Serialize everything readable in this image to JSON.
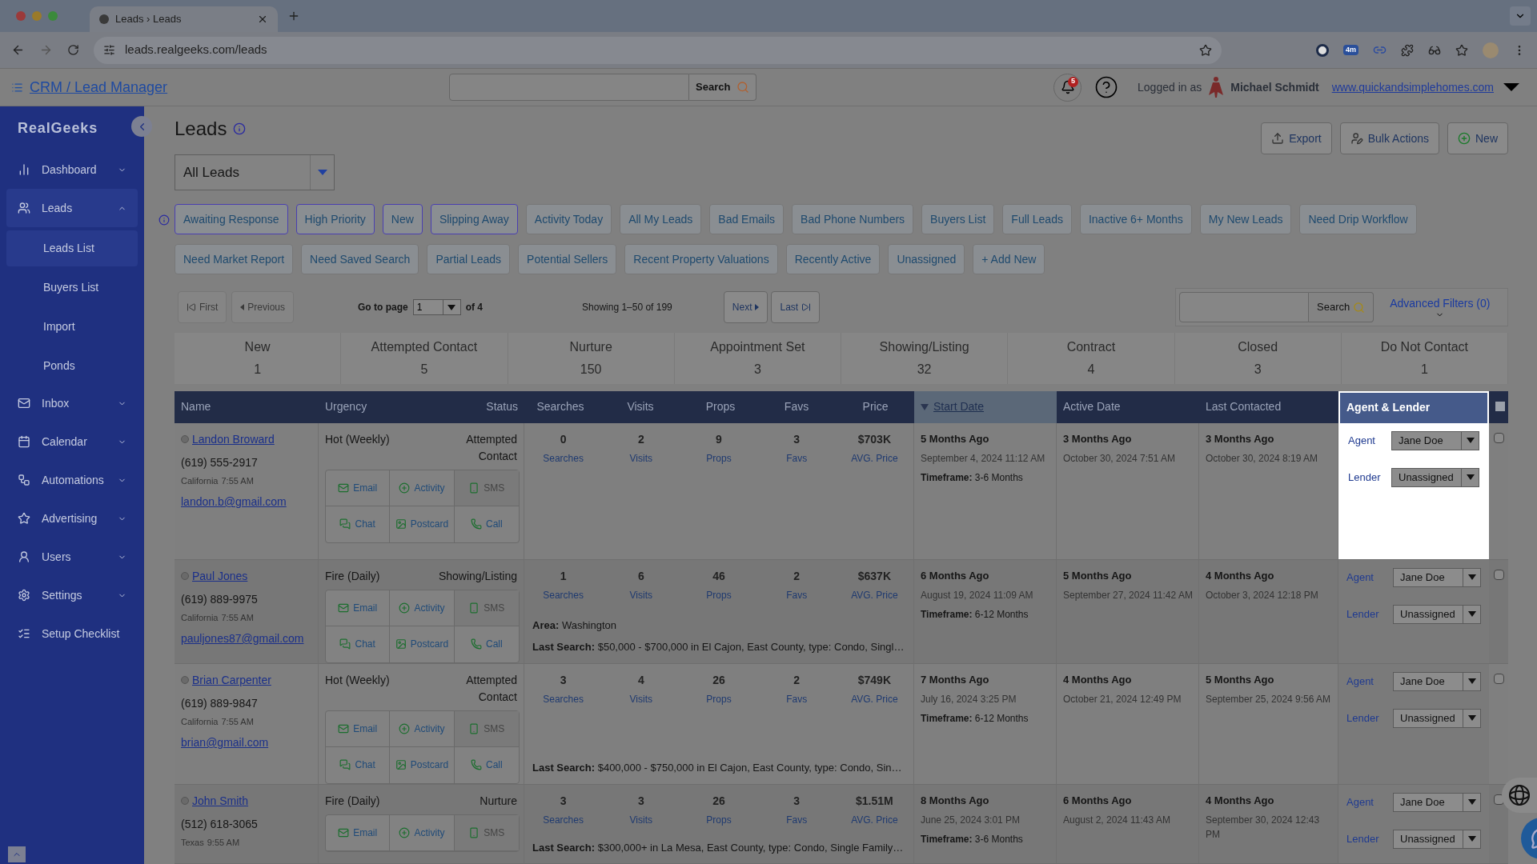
{
  "browser": {
    "tab_title": "Leads › Leads",
    "url": "leads.realgeeks.com/leads",
    "extension_badge": "4m"
  },
  "header": {
    "title": "CRM / Lead Manager",
    "search_button": "Search",
    "notifications": "5",
    "logged_in_label": "Logged in as",
    "user": "Michael Schmidt",
    "site": "www.quickandsimplehomes.com"
  },
  "sidebar": {
    "logo": "RealGeeks",
    "items": [
      {
        "label": "Dashboard",
        "kind": "menu",
        "expanded": false
      },
      {
        "label": "Leads",
        "kind": "menu",
        "expanded": true,
        "children": [
          {
            "label": "Leads List",
            "selected": true
          },
          {
            "label": "Buyers List",
            "selected": false
          },
          {
            "label": "Import",
            "selected": false
          },
          {
            "label": "Ponds",
            "selected": false
          }
        ]
      },
      {
        "label": "Inbox",
        "kind": "menu",
        "expanded": false
      },
      {
        "label": "Calendar",
        "kind": "menu",
        "expanded": false
      },
      {
        "label": "Automations",
        "kind": "menu",
        "expanded": false
      },
      {
        "label": "Advertising",
        "kind": "menu",
        "expanded": false
      },
      {
        "label": "Users",
        "kind": "menu",
        "expanded": false
      },
      {
        "label": "Settings",
        "kind": "menu",
        "expanded": false
      },
      {
        "label": "Setup Checklist",
        "kind": "link",
        "expanded": false
      }
    ]
  },
  "page": {
    "title": "Leads",
    "view": "All Leads",
    "actions": [
      "Export",
      "Bulk Actions",
      "New"
    ]
  },
  "filters": [
    {
      "label": "Awaiting Response",
      "selected": true
    },
    {
      "label": "High Priority",
      "selected": true
    },
    {
      "label": "New",
      "selected": true
    },
    {
      "label": "Slipping Away",
      "selected": true
    },
    {
      "label": "Activity Today",
      "selected": false
    },
    {
      "label": "All My Leads",
      "selected": false
    },
    {
      "label": "Bad Emails",
      "selected": false
    },
    {
      "label": "Bad Phone Numbers",
      "selected": false
    },
    {
      "label": "Buyers List",
      "selected": false
    },
    {
      "label": "Full Leads",
      "selected": false
    },
    {
      "label": "Inactive 6+ Months",
      "selected": false
    },
    {
      "label": "My New Leads",
      "selected": false
    },
    {
      "label": "Need Drip Workflow",
      "selected": false
    },
    {
      "label": "Need Market Report",
      "selected": false
    },
    {
      "label": "Need Saved Search",
      "selected": false
    },
    {
      "label": "Partial Leads",
      "selected": false
    },
    {
      "label": "Potential Sellers",
      "selected": false
    },
    {
      "label": "Recent Property Valuations",
      "selected": false
    },
    {
      "label": "Recently Active",
      "selected": false
    },
    {
      "label": "Unassigned",
      "selected": false
    },
    {
      "label": "+ Add New",
      "selected": false
    }
  ],
  "pagination": {
    "first": "First",
    "first_disabled": true,
    "previous": "Previous",
    "previous_disabled": true,
    "go_to_label": "Go to page",
    "page": "1",
    "of": "of 4",
    "showing": "Showing 1–50 of 199",
    "next": "Next",
    "last": "Last",
    "search_button": "Search",
    "advanced_filters": "Advanced Filters (0)"
  },
  "stages": [
    {
      "label": "New",
      "count": "1"
    },
    {
      "label": "Attempted Contact",
      "count": "5"
    },
    {
      "label": "Nurture",
      "count": "150"
    },
    {
      "label": "Appointment Set",
      "count": "3"
    },
    {
      "label": "Showing/Listing",
      "count": "32"
    },
    {
      "label": "Contract",
      "count": "4"
    },
    {
      "label": "Closed",
      "count": "3"
    },
    {
      "label": "Do Not Contact",
      "count": "1"
    }
  ],
  "columns": [
    {
      "label": "Name",
      "sorted": false,
      "highlighted": false
    },
    {
      "label": "Urgency",
      "sorted": false,
      "highlighted": false
    },
    {
      "label": "Status",
      "sorted": false,
      "highlighted": false
    },
    {
      "label": "Searches",
      "sorted": false,
      "highlighted": false
    },
    {
      "label": "Visits",
      "sorted": false,
      "highlighted": false
    },
    {
      "label": "Props",
      "sorted": false,
      "highlighted": false
    },
    {
      "label": "Favs",
      "sorted": false,
      "highlighted": false
    },
    {
      "label": "Price",
      "sorted": false,
      "highlighted": false
    },
    {
      "label": "Start Date",
      "sorted": true,
      "highlighted": false
    },
    {
      "label": "Active Date",
      "sorted": false,
      "highlighted": false
    },
    {
      "label": "Last Contacted",
      "sorted": false,
      "highlighted": false
    },
    {
      "label": "Agent & Lender",
      "sorted": false,
      "highlighted": true
    }
  ],
  "select_all_checked": false,
  "rows": [
    {
      "name": "Landon Broward",
      "phone": "(619) 555-2917",
      "region": "California",
      "time": "7:55 AM",
      "email": "landon.b@gmail.com",
      "urgency": "Hot (Weekly)",
      "status": "Attempted Contact",
      "actions": [
        {
          "label": "Email",
          "disabled": false
        },
        {
          "label": "Activity",
          "disabled": false
        },
        {
          "label": "SMS",
          "disabled": true
        },
        {
          "label": "Chat",
          "disabled": false
        },
        {
          "label": "Postcard",
          "disabled": false
        },
        {
          "label": "Call",
          "disabled": false
        }
      ],
      "stats": [
        {
          "value": "0",
          "label": "Searches"
        },
        {
          "value": "2",
          "label": "Visits"
        },
        {
          "value": "9",
          "label": "Props"
        },
        {
          "value": "3",
          "label": "Favs"
        },
        {
          "value": "$703K",
          "label": "AVG. Price"
        }
      ],
      "start_ago": "5 Months Ago",
      "start_date": "September 4, 2024 11:12 AM",
      "timeframe_label": "Timeframe:",
      "timeframe": "3-6 Months",
      "active_ago": "3 Months Ago",
      "active_date": "October 30, 2024 7:51 AM",
      "contacted_ago": "3 Months Ago",
      "contacted_date": "October 30, 2024 8:19 AM",
      "agent_label": "Agent",
      "agent": "Jane Doe",
      "lender_label": "Lender",
      "lender": "Unassigned",
      "highlighted": true,
      "checked": false
    },
    {
      "name": "Paul Jones",
      "phone": "(619) 889-9975",
      "region": "California",
      "time": "7:55 AM",
      "email": "pauljones87@gmail.com",
      "urgency": "Fire (Daily)",
      "status": "Showing/Listing",
      "actions": [
        {
          "label": "Email",
          "disabled": false
        },
        {
          "label": "Activity",
          "disabled": false
        },
        {
          "label": "SMS",
          "disabled": true
        },
        {
          "label": "Chat",
          "disabled": false
        },
        {
          "label": "Postcard",
          "disabled": false
        },
        {
          "label": "Call",
          "disabled": false
        }
      ],
      "stats": [
        {
          "value": "1",
          "label": "Searches"
        },
        {
          "value": "6",
          "label": "Visits"
        },
        {
          "value": "46",
          "label": "Props"
        },
        {
          "value": "2",
          "label": "Favs"
        },
        {
          "value": "$637K",
          "label": "AVG. Price"
        }
      ],
      "area_label": "Area:",
      "area": "Washington",
      "last_search_label": "Last Search:",
      "last_search": "$50,000 - $700,000 in El Cajon, East County, type: Condo, Singl…",
      "start_ago": "6 Months Ago",
      "start_date": "August 19, 2024 11:09 AM",
      "timeframe_label": "Timeframe:",
      "timeframe": "6-12 Months",
      "active_ago": "5 Months Ago",
      "active_date": "September 27, 2024 11:42 AM",
      "contacted_ago": "4 Months Ago",
      "contacted_date": "October 3, 2024 12:18 PM",
      "agent_label": "Agent",
      "agent": "Jane Doe",
      "lender_label": "Lender",
      "lender": "Unassigned",
      "highlighted": false,
      "checked": false
    },
    {
      "name": "Brian Carpenter",
      "phone": "(619) 889-9847",
      "region": "California",
      "time": "7:55 AM",
      "email": "brian@gmail.com",
      "urgency": "Hot (Weekly)",
      "status": "Attempted Contact",
      "actions": [
        {
          "label": "Email",
          "disabled": false
        },
        {
          "label": "Activity",
          "disabled": false
        },
        {
          "label": "SMS",
          "disabled": true
        },
        {
          "label": "Chat",
          "disabled": false
        },
        {
          "label": "Postcard",
          "disabled": false
        },
        {
          "label": "Call",
          "disabled": false
        }
      ],
      "stats": [
        {
          "value": "3",
          "label": "Searches"
        },
        {
          "value": "4",
          "label": "Visits"
        },
        {
          "value": "26",
          "label": "Props"
        },
        {
          "value": "2",
          "label": "Favs"
        },
        {
          "value": "$749K",
          "label": "AVG. Price"
        }
      ],
      "last_search_label": "Last Search:",
      "last_search": "$400,000 - $750,000 in El Cajon, East County, type: Condo, Sin…",
      "start_ago": "7 Months Ago",
      "start_date": "July 16, 2024 3:25 PM",
      "timeframe_label": "Timeframe:",
      "timeframe": "6-12 Months",
      "active_ago": "4 Months Ago",
      "active_date": "October 21, 2024 12:49 PM",
      "contacted_ago": "5 Months Ago",
      "contacted_date": "September 25, 2024 9:56 AM",
      "agent_label": "Agent",
      "agent": "Jane Doe",
      "lender_label": "Lender",
      "lender": "Unassigned",
      "highlighted": false,
      "checked": false
    },
    {
      "name": "John Smith",
      "phone": "(512) 618-3065",
      "region": "Texas",
      "time": "9:55 AM",
      "urgency": "Fire (Daily)",
      "status": "Nurture",
      "actions": [
        {
          "label": "Email",
          "disabled": false
        },
        {
          "label": "Activity",
          "disabled": false
        },
        {
          "label": "SMS",
          "disabled": true
        }
      ],
      "stats": [
        {
          "value": "3",
          "label": "Searches"
        },
        {
          "value": "3",
          "label": "Visits"
        },
        {
          "value": "26",
          "label": "Props"
        },
        {
          "value": "3",
          "label": "Favs"
        },
        {
          "value": "$1.51M",
          "label": "AVG. Price"
        }
      ],
      "last_search_label": "Last Search:",
      "last_search": "$300,000+ in La Mesa, East County, type: Condo, Single Family…",
      "start_ago": "8 Months Ago",
      "start_date": "June 25, 2024 3:01 PM",
      "timeframe_label": "Timeframe:",
      "timeframe": "3-6 Months",
      "active_ago": "6 Months Ago",
      "active_date": "August 2, 2024 11:43 AM",
      "contacted_ago": "4 Months Ago",
      "contacted_date": "September 30, 2024 12:43 PM",
      "agent_label": "Agent",
      "agent": "Jane Doe",
      "lender_label": "Lender",
      "lender": "Unassigned",
      "highlighted": false,
      "checked": false
    }
  ]
}
